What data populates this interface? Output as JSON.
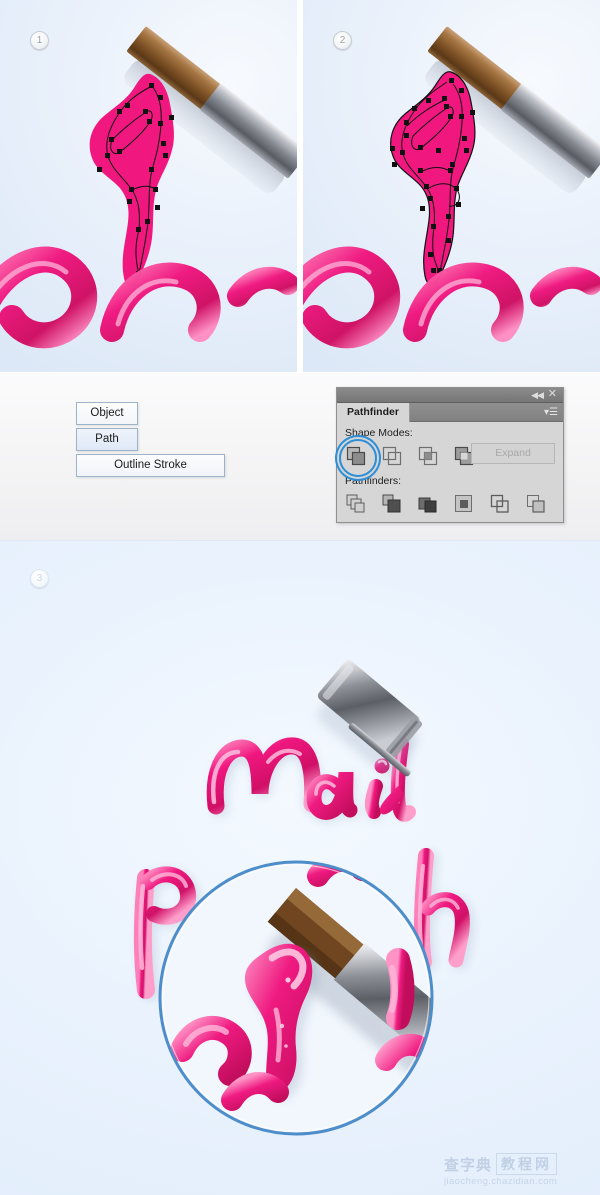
{
  "panels": {
    "step1": {
      "badge": "1",
      "caption_hidden": ""
    },
    "step2": {
      "badge": "2"
    },
    "step3": {
      "badge": "3"
    }
  },
  "menu_commands": {
    "object_label": "Object",
    "path_label": "Path",
    "outline_stroke_label": "Outline Stroke"
  },
  "pathfinder": {
    "tab_label": "Pathfinder",
    "collapse_icon": "◀◀",
    "close_icon": "✕",
    "menu_icon": "▾☰",
    "shape_modes_label": "Shape Modes:",
    "pathfinders_label": "Pathfinders:",
    "expand_label": "Expand",
    "expand_enabled": false,
    "shape_modes": [
      {
        "name": "unite",
        "selected": true
      },
      {
        "name": "minus-front",
        "selected": false
      },
      {
        "name": "intersect",
        "selected": false
      },
      {
        "name": "exclude",
        "selected": false
      }
    ],
    "pathfinders": [
      {
        "name": "divide"
      },
      {
        "name": "trim"
      },
      {
        "name": "merge"
      },
      {
        "name": "crop"
      },
      {
        "name": "outline"
      },
      {
        "name": "minus-back"
      }
    ],
    "selection_color": "#2e8fd6",
    "panel_bg": "#d6d6d6"
  },
  "artwork": {
    "word": "Nail",
    "paint_color": "#f0177f",
    "paint_color_dark": "#c0105f",
    "paint_color_light": "#ff6fb0",
    "background_color": "#e9f2fd",
    "brush_metal_color": "#7f838c",
    "brush_wood_color": "#7d5125",
    "magnifier_stroke": "#4d8dc9"
  },
  "watermark": {
    "cn_left": "查字典",
    "cn_right": "教程网",
    "url": "jiaocheng.chazidian.com"
  }
}
